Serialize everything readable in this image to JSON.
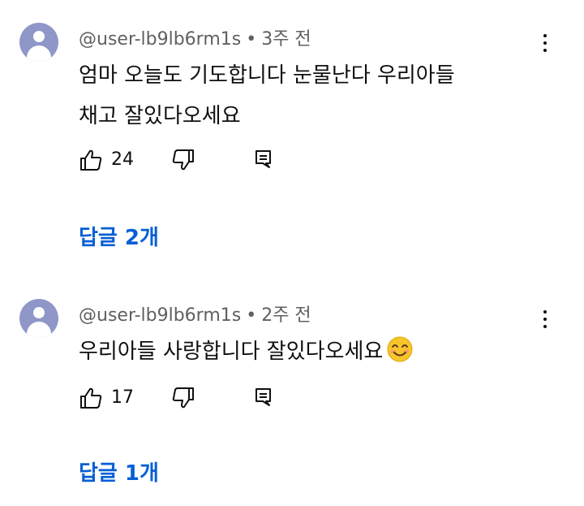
{
  "comments": [
    {
      "author": "@user-lb9lb6rm1s",
      "separator": "•",
      "time": "3주 전",
      "text": "엄마 오늘도 기도합니다 눈물난다 우리아들\n채고 잘있다오세요",
      "likes": "24",
      "replies_label": "답글 2개"
    },
    {
      "author": "@user-lb9lb6rm1s",
      "separator": "•",
      "time": "2주 전",
      "text": "우리아들 사랑합니다 잘있다오세요",
      "emoji": "smiling-face-icon",
      "likes": "17",
      "replies_label": "답글 1개"
    }
  ],
  "colors": {
    "link": "#065fd4",
    "meta": "#606060",
    "avatar": "#8f96c8"
  }
}
